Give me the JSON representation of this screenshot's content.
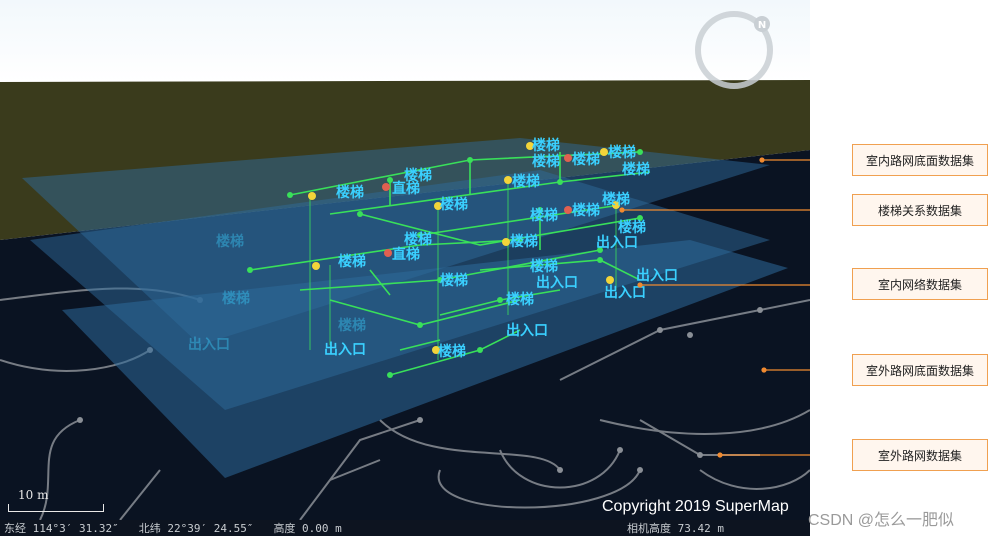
{
  "status": {
    "lon": "东经 114°3′ 31.32″",
    "lat": "北纬 22°39′ 24.55″",
    "height": "高度 0.00 m",
    "camera_height": "相机高度 73.42 m"
  },
  "scale_bar": {
    "label": "10 m"
  },
  "copyright": "Copyright 2019 SuperMap",
  "watermark": "CSDN @怎么一肥似",
  "compass": {
    "north": "N"
  },
  "callouts": [
    "室内路网底面数据集",
    "楼梯关系数据集",
    "室内网络数据集",
    "室外路网底面数据集",
    "室外路网数据集"
  ],
  "map_labels": {
    "stair": "楼梯",
    "elevator": "直梯",
    "entrance": "出入口"
  },
  "colors": {
    "sky": "#ffffff",
    "grass": "#3a3b1c",
    "ground": "#0a1322",
    "plane": "#2d6a9a",
    "network": "#39e05a",
    "label": "#3ad0ff",
    "callout_line": "#f08a30"
  }
}
